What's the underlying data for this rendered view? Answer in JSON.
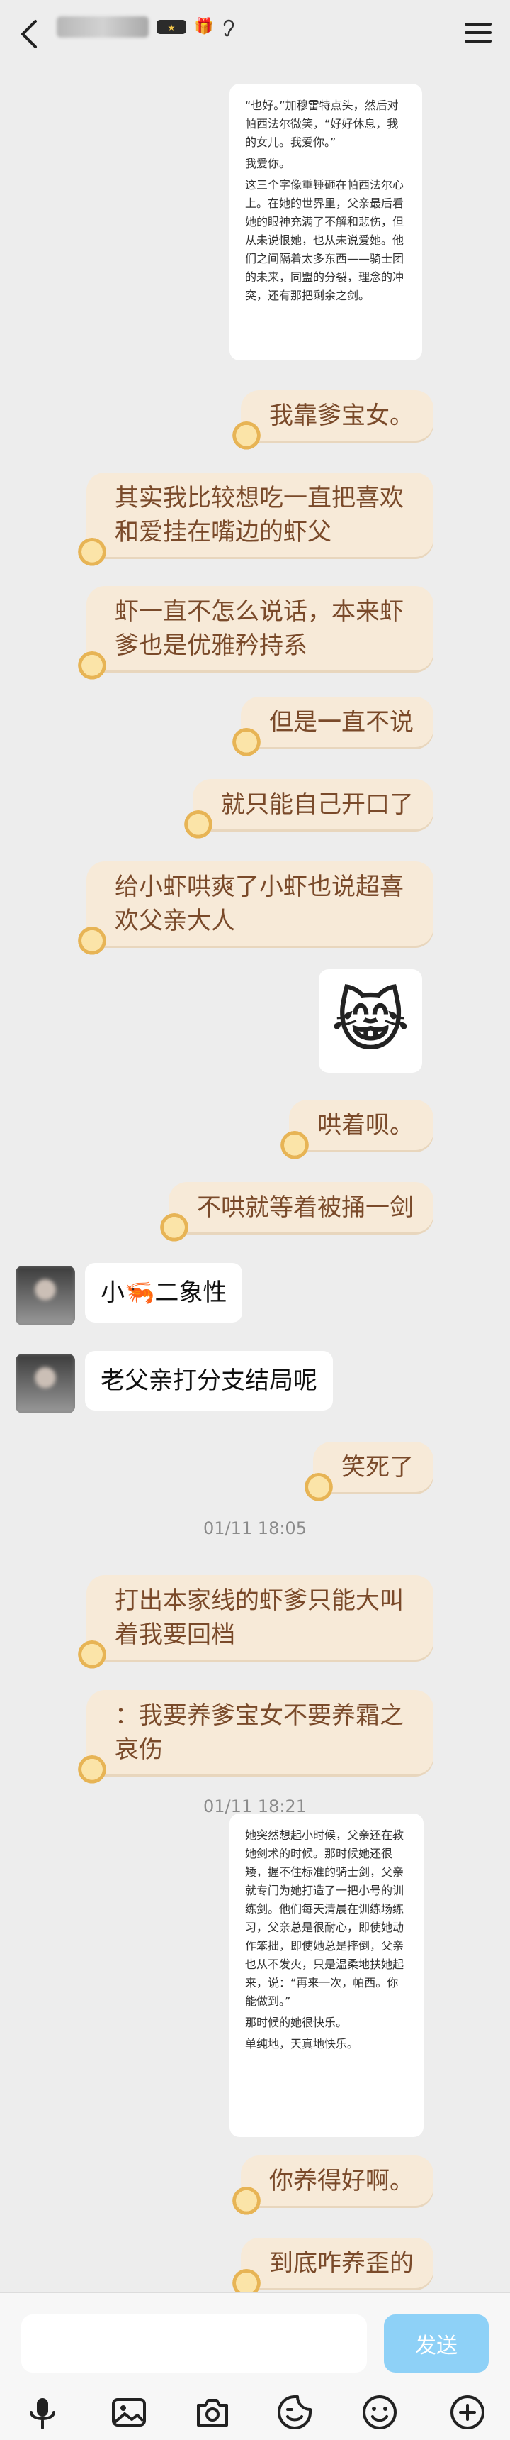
{
  "header": {
    "badge_icons": [
      "🎁"
    ],
    "back_icon": "chevron-left-icon",
    "menu_icon": "hamburger-icon"
  },
  "colors": {
    "background": "#ededed",
    "my_bubble": "#f7ead8",
    "my_text": "#7a4a2a",
    "send_button": "#8ed1f7"
  },
  "messages": {
    "card1": [
      "“也好。”加穆雷特点头，然后对帕西法尔微笑，“好好休息，我的女儿。我爱你。”",
      "我爱你。",
      "这三个字像重锤砸在帕西法尔心上。在她的世界里，父亲最后看她的眼神充满了不解和悲伤，但从未说恨她，也从未说爱她。他们之间隔着太多东西——骑士团的未来，同盟的分裂，理念的冲突，还有那把剩余之剑。"
    ],
    "m1": "我靠爹宝女。",
    "m2": "其实我比较想吃一直把喜欢和爱挂在嘴边的虾父",
    "m3": "虾一直不怎么说话，本来虾爹也是优雅矜持系",
    "m4": "但是一直不说",
    "m5": "就只能自己开口了",
    "m6": "给小虾哄爽了小虾也说超喜欢父亲大人",
    "emoji": "😹",
    "m7": "哄着呗。",
    "m8": "不哄就等着被捅一剑",
    "o1_prefix": "小",
    "o1_emoji": "🦐",
    "o1_suffix": "二象性",
    "o2": "老父亲打分支结局呢",
    "m9": "笑死了",
    "ts1": "01/11 18:05",
    "m10": "打出本家线的虾爹只能大叫着我要回档",
    "m11": "：我要养爹宝女不要养霜之哀伤",
    "ts2": "01/11 18:21",
    "card2": [
      "她突然想起小时候，父亲还在教她剑术的时候。那时候她还很矮，握不住标准的骑士剑，父亲就专门为她打造了一把小号的训练剑。他们每天清晨在训练场练习，父亲总是很耐心，即使她动作笨拙，即使她总是摔倒，父亲也从不发火，只是温柔地扶她起来，说：“再来一次，帕西。你能做到。”",
      "那时候的她很快乐。",
      "单纯地，天真地快乐。"
    ],
    "m12": "你养得好啊。",
    "m13": "到底咋养歪的"
  },
  "input": {
    "placeholder": "",
    "value": "",
    "send_label": "发送"
  },
  "toolbar": [
    "mic-icon",
    "image-icon",
    "camera-icon",
    "sticker-icon",
    "emoji-icon",
    "plus-icon"
  ]
}
